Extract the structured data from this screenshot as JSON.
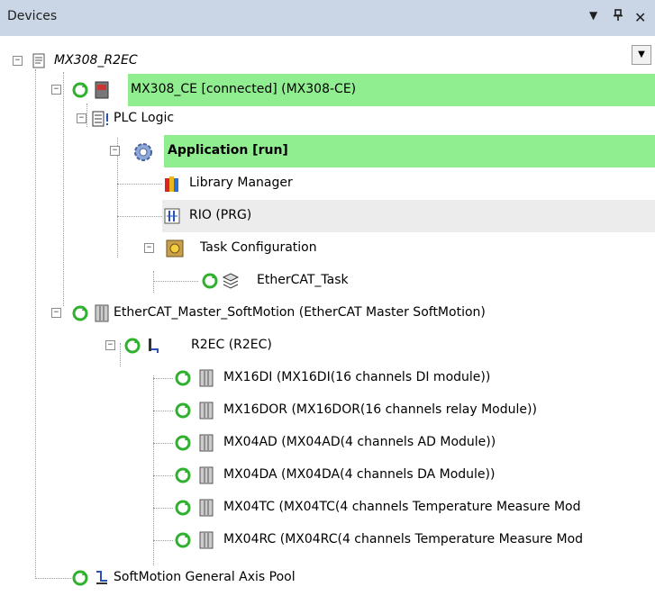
{
  "panel": {
    "title": "Devices",
    "dropdown_glyph": "▼",
    "pin_glyph": "H",
    "close_glyph": "✕"
  },
  "tree": {
    "project": "MX308_R2EC",
    "device": "MX308_CE [connected] (MX308-CE)",
    "plc_logic": "PLC Logic",
    "application": "Application [run]",
    "library_manager": "Library Manager",
    "rio": "RIO (PRG)",
    "task_config": "Task Configuration",
    "ethercat_task": "EtherCAT_Task",
    "ethercat_master": "EtherCAT_Master_SoftMotion (EtherCAT Master SoftMotion)",
    "r2ec": "R2EC (R2EC)",
    "modules": [
      "MX16DI (MX16DI(16 channels DI module))",
      "MX16DOR (MX16DOR(16 channels relay Module))",
      "MX04AD (MX04AD(4 channels AD Module))",
      "MX04DA (MX04DA(4 channels DA Module))",
      "MX04TC (MX04TC(4 channels Temperature Measure Mod",
      "MX04RC (MX04RC(4 channels Temperature Measure Mod"
    ],
    "axis_pool": "SoftMotion General Axis Pool"
  },
  "colors": {
    "connected_bg": "#90ee90",
    "titlebar": "#cad6e5",
    "selected_bg": "#ececec",
    "status_green": "#2fb12f"
  },
  "icons": [
    "document-icon",
    "refresh-status-icon",
    "plc-device-icon",
    "plc-logic-icon",
    "gear-icon",
    "library-icon",
    "pou-icon",
    "task-config-icon",
    "task-icon",
    "module-icon",
    "coupler-icon",
    "axis-pool-icon"
  ]
}
